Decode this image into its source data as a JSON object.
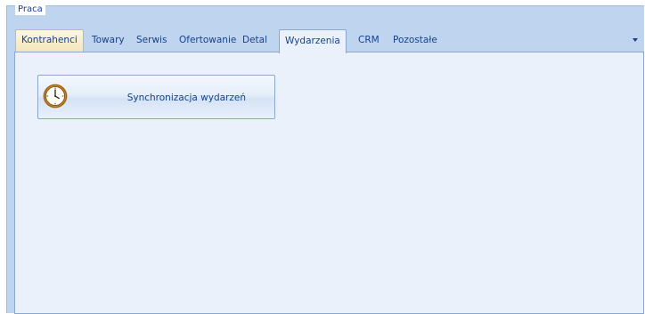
{
  "group": {
    "title": "Praca"
  },
  "tabs": [
    {
      "label": "Kontrahenci",
      "state": "hover"
    },
    {
      "label": "Towary",
      "state": "normal"
    },
    {
      "label": "Serwis",
      "state": "normal"
    },
    {
      "label": "Ofertowanie",
      "state": "normal"
    },
    {
      "label": "Detal",
      "state": "normal"
    },
    {
      "label": "Wydarzenia",
      "state": "active"
    },
    {
      "label": "CRM",
      "state": "normal"
    },
    {
      "label": "Pozostałe",
      "state": "normal"
    }
  ],
  "content": {
    "buttons": [
      {
        "label": "Synchronizacja wydarzeń",
        "icon": "clock-icon"
      }
    ]
  },
  "colors": {
    "accent_text": "#15428b",
    "panel_bg": "#eaf1fb",
    "frame_bg": "#bfd4ef",
    "border": "#8ba7cf",
    "hover_tab": "#f3e6b9",
    "clock_ring": "#c8872e"
  }
}
